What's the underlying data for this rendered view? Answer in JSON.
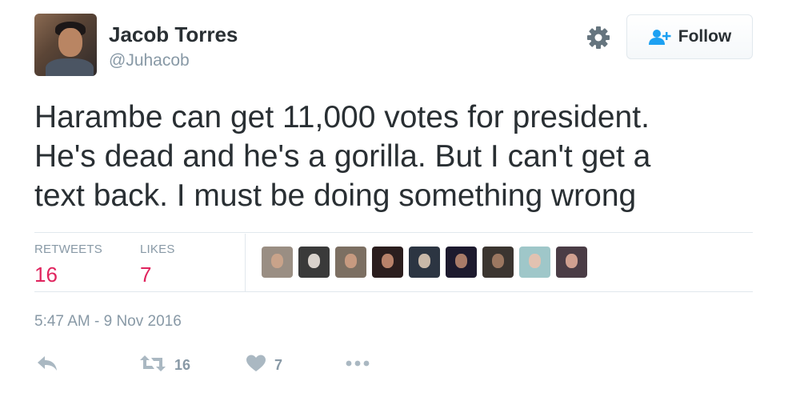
{
  "user": {
    "name": "Jacob Torres",
    "handle": "@Juhacob",
    "avatar_icon": "profile-photo"
  },
  "header": {
    "settings_icon": "gear-icon",
    "follow_label": "Follow",
    "follow_icon": "follow-user-icon"
  },
  "tweet": {
    "lines": [
      "Harambe can get 11,000 votes for president.",
      "He's dead and he's a gorilla. But I can't get a",
      "text back. I must be doing something wrong"
    ]
  },
  "stats": {
    "retweets_label": "RETWEETS",
    "retweets_value": "16",
    "likes_label": "LIKES",
    "likes_value": "7",
    "accent_color": "#e0245e"
  },
  "likers": [
    {
      "icon": "liker-avatar",
      "bg": "#9a8e83",
      "face": "#c9a38a"
    },
    {
      "icon": "liker-avatar",
      "bg": "#3a3a3a",
      "face": "#d9d2cc"
    },
    {
      "icon": "liker-avatar",
      "bg": "#7c6f62",
      "face": "#c79a80"
    },
    {
      "icon": "liker-avatar",
      "bg": "#2b1e1e",
      "face": "#b8826a"
    },
    {
      "icon": "liker-avatar",
      "bg": "#2c3542",
      "face": "#c8b8a8"
    },
    {
      "icon": "liker-avatar",
      "bg": "#1d1a2e",
      "face": "#a97b68"
    },
    {
      "icon": "liker-avatar",
      "bg": "#3b3530",
      "face": "#9b7760"
    },
    {
      "icon": "liker-avatar",
      "bg": "#9fc7c9",
      "face": "#e2c2b1"
    },
    {
      "icon": "liker-avatar",
      "bg": "#4a3c45",
      "face": "#d0a090"
    }
  ],
  "timestamp": "5:47 AM - 9 Nov 2016",
  "actions": {
    "reply_icon": "reply-icon",
    "retweet_icon": "retweet-icon",
    "retweet_count": "16",
    "like_icon": "heart-icon",
    "like_count": "7",
    "more_icon": "more-icon"
  }
}
